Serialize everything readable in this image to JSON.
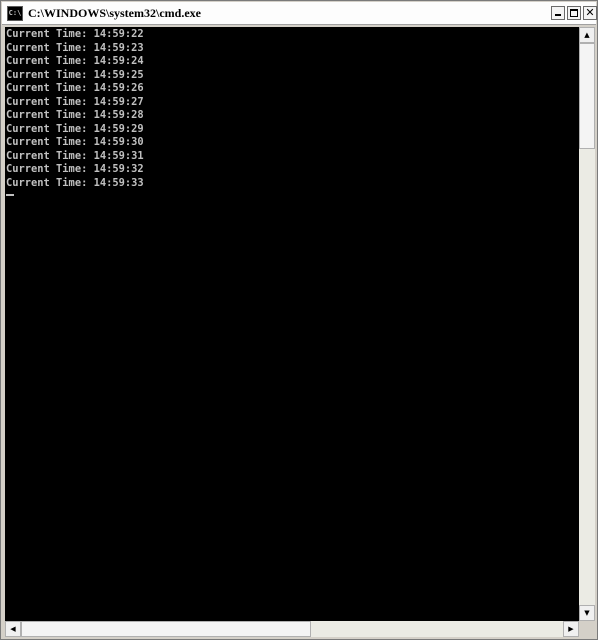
{
  "window": {
    "title": "C:\\WINDOWS\\system32\\cmd.exe",
    "icon_label": "C:\\",
    "close_glyph": "✕"
  },
  "console": {
    "lines": [
      "Current Time: 14:59:22",
      "Current Time: 14:59:23",
      "Current Time: 14:59:24",
      "Current Time: 14:59:25",
      "Current Time: 14:59:26",
      "Current Time: 14:59:27",
      "Current Time: 14:59:28",
      "Current Time: 14:59:29",
      "Current Time: 14:59:30",
      "Current Time: 14:59:31",
      "Current Time: 14:59:32",
      "Current Time: 14:59:33"
    ]
  },
  "scrollbars": {
    "up_arrow": "▲",
    "down_arrow": "▼",
    "left_arrow": "◀",
    "right_arrow": "▶"
  },
  "colors": {
    "console_bg": "#000000",
    "console_text": "#c0c0c0"
  }
}
